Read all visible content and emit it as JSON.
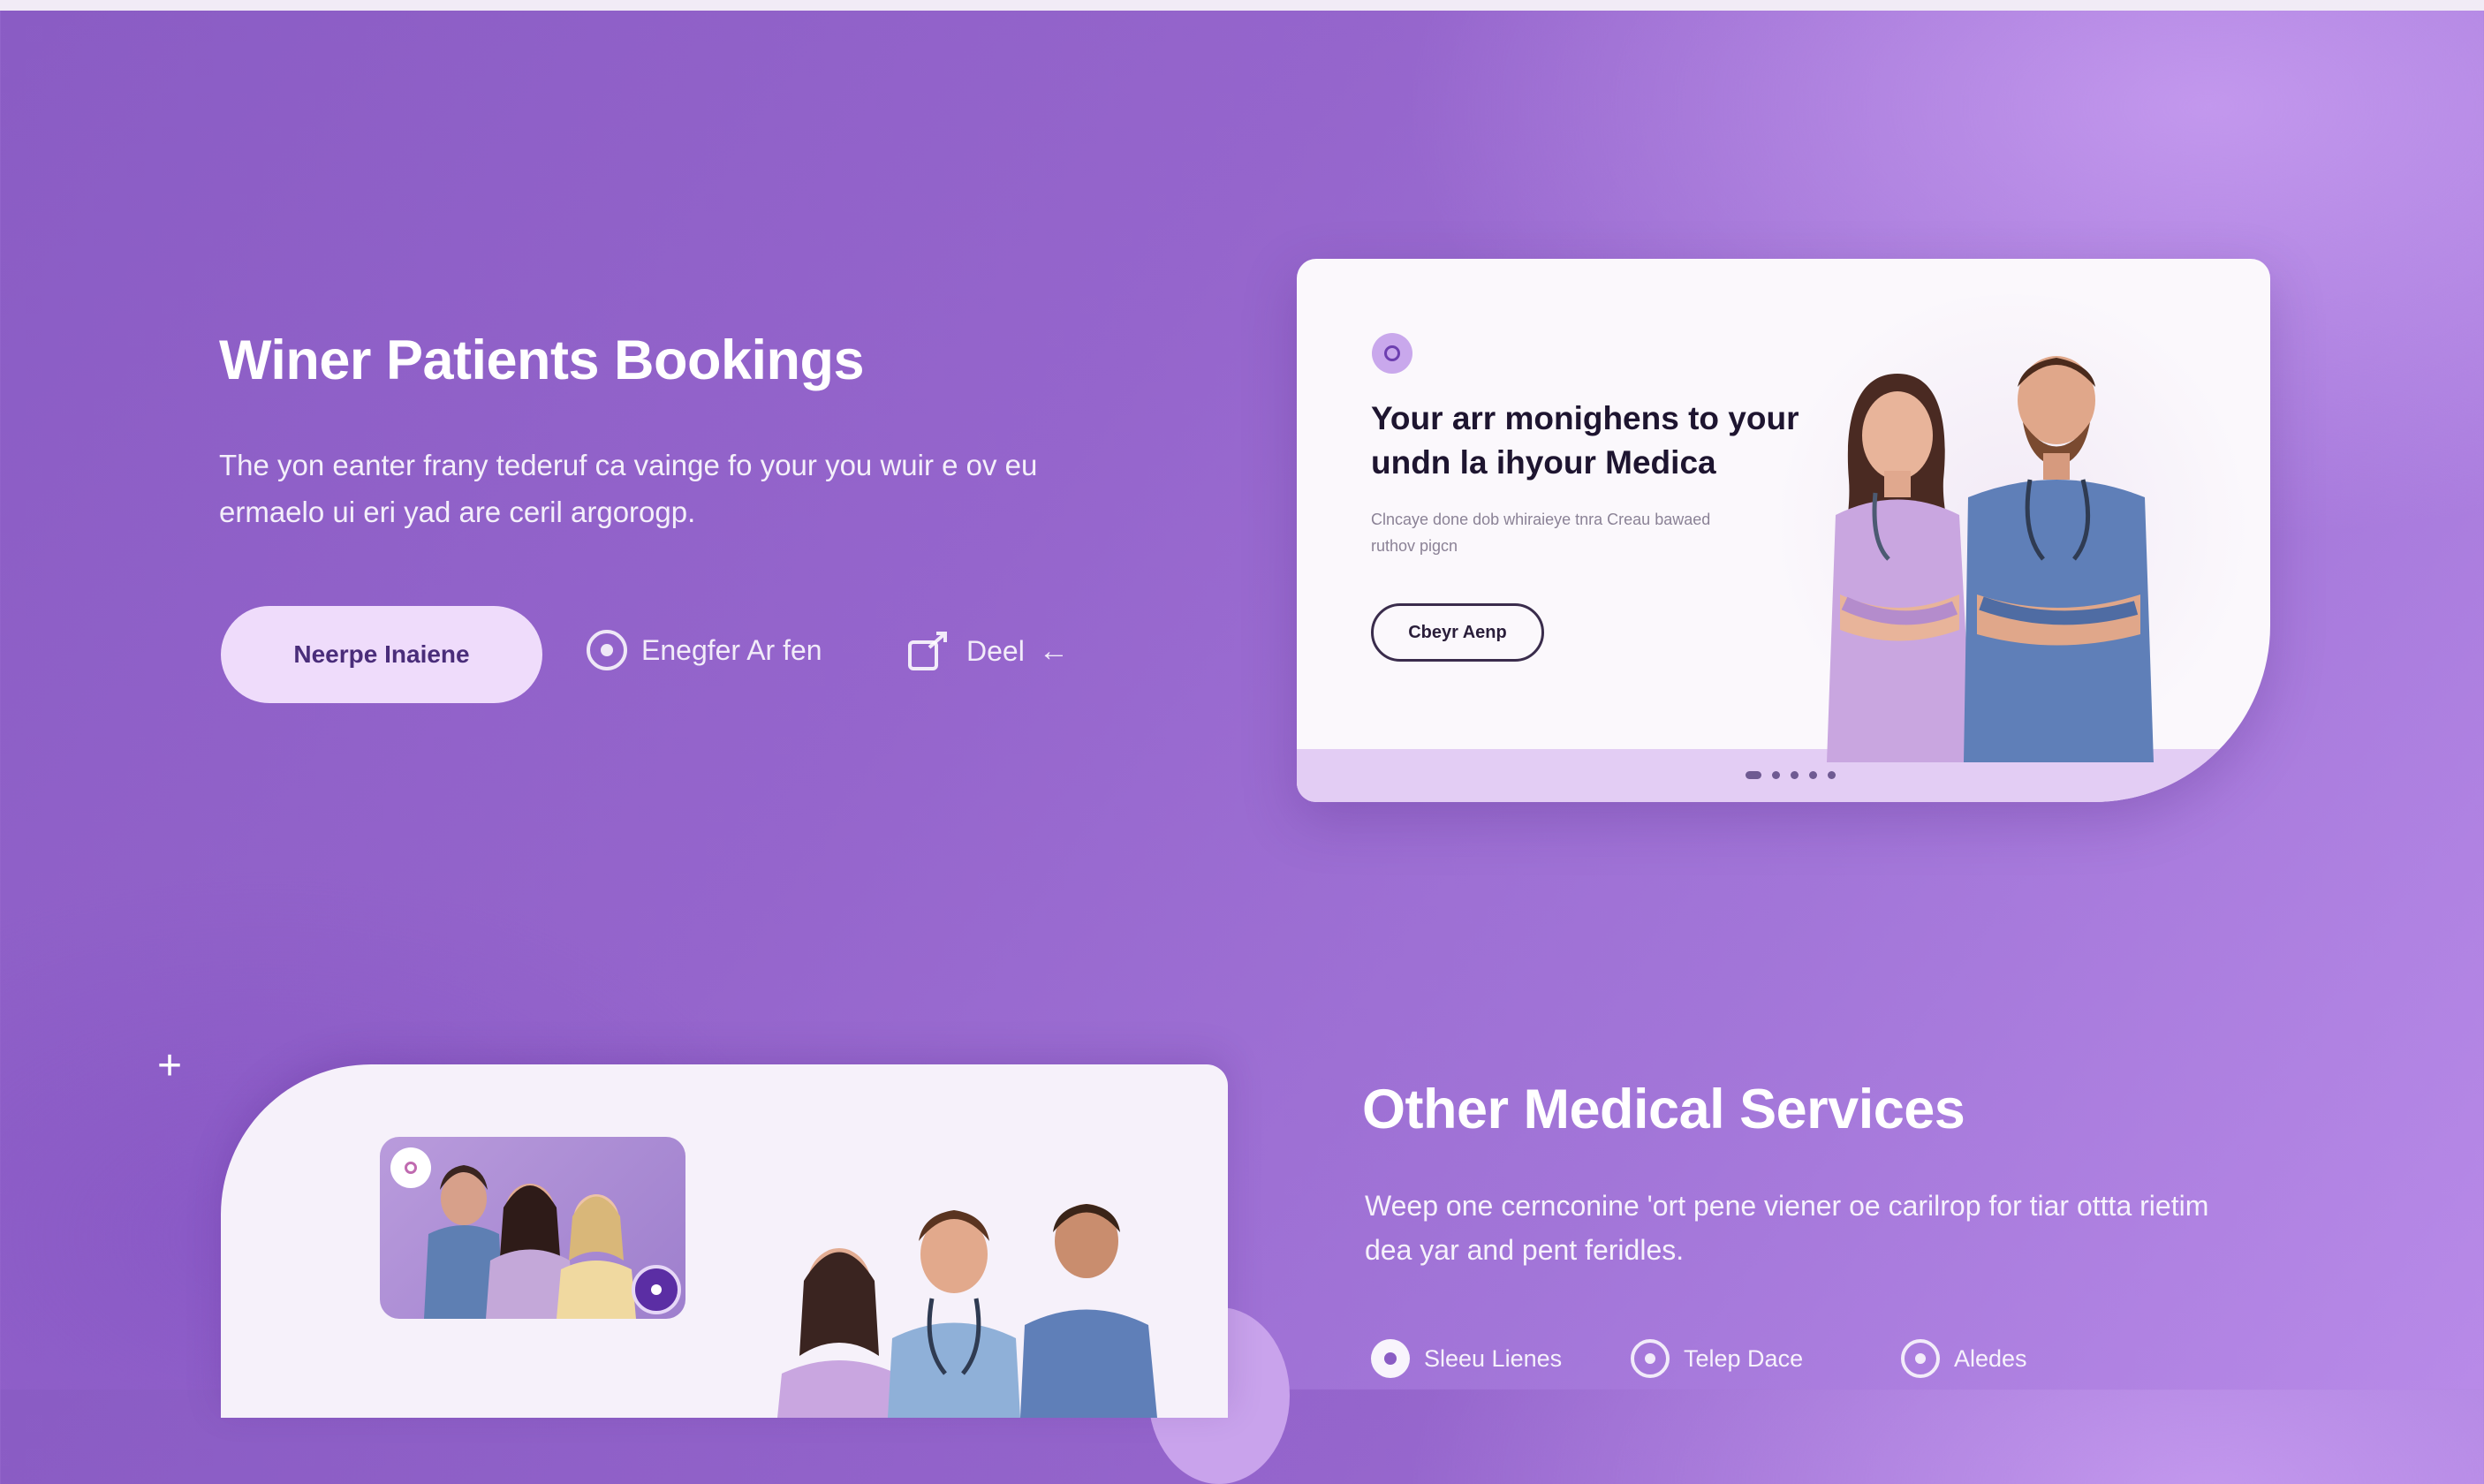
{
  "hero": {
    "title": "Winer Patients Bookings",
    "description": "The yon eanter frany tederuf ca vainge fo your you wuir e ov eu ermaelo ui eri yad are ceril argorogp.",
    "primary_button": "Neerpe Inaiene",
    "link_1": "Enegfer Ar fen",
    "link_2": "Deel"
  },
  "feature_card": {
    "title": "Your arr monighens to your undn la ihyour Medica",
    "body": "Clncaye done dob whiraieye tnra Creau bawaed ruthov pigcn",
    "button": "Cbeyr Aenp"
  },
  "services": {
    "title": "Other Medical Services",
    "description": "Weep one cernconine 'ort pene viener oe carilrop for tiar ottta rietim dea yar and pent feridles.",
    "items": [
      {
        "label": "Sleeu Lienes",
        "icon": "stethoscope-icon"
      },
      {
        "label": "Telep Dace",
        "icon": "heart-icon"
      },
      {
        "label": "Aledes",
        "icon": "pill-icon"
      }
    ]
  },
  "colors": {
    "background": "#9565cc",
    "accent": "#efdcfb",
    "card": "#fbf8fc",
    "scrub_lilac": "#c9a6e0",
    "scrub_blue": "#5f7fb8"
  }
}
